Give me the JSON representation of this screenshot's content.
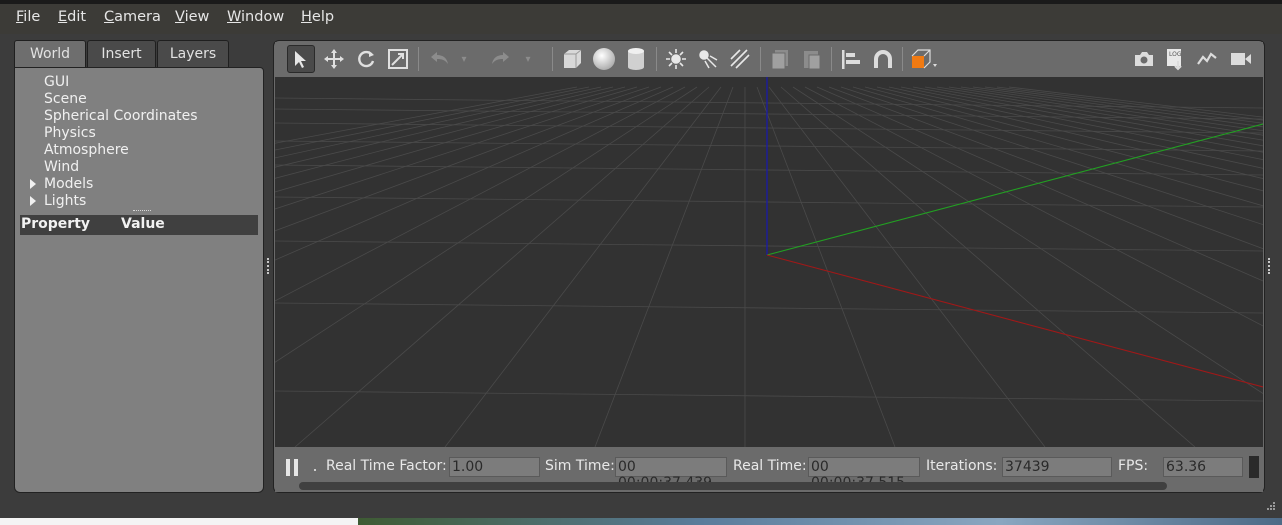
{
  "menu": [
    {
      "accel": "F",
      "rest": "ile"
    },
    {
      "accel": "E",
      "rest": "dit"
    },
    {
      "accel": "C",
      "rest": "amera"
    },
    {
      "accel": "V",
      "rest": "iew"
    },
    {
      "accel": "W",
      "rest": "indow"
    },
    {
      "accel": "H",
      "rest": "elp"
    }
  ],
  "tabs": {
    "world": "World",
    "insert": "Insert",
    "layers": "Layers"
  },
  "tree": [
    "GUI",
    "Scene",
    "Spherical Coordinates",
    "Physics",
    "Atmosphere",
    "Wind",
    "Models",
    "Lights"
  ],
  "props": {
    "property": "Property",
    "value": "Value"
  },
  "toolbar_icons": [
    "select-arrow-icon",
    "translate-icon",
    "rotate-icon",
    "scale-icon",
    "undo-icon",
    "undo-dropdown-icon",
    "redo-icon",
    "redo-dropdown-icon",
    "box-icon",
    "sphere-icon",
    "cylinder-icon",
    "point-light-icon",
    "spot-light-icon",
    "directional-light-icon",
    "copy-icon",
    "paste-icon",
    "align-icon",
    "magnet-icon",
    "view-angle-icon",
    "screenshot-icon",
    "log-icon",
    "plot-icon",
    "record-video-icon"
  ],
  "status": {
    "rtf_label": "Real Time Factor:",
    "rtf": "1.00",
    "sim_label": "Sim Time:",
    "sim": "00 00:00:37.439",
    "real_label": "Real Time:",
    "real": "00 00:00:37.515",
    "iter_label": "Iterations:",
    "iter": "37439",
    "fps_label": "FPS:",
    "fps": "63.36"
  },
  "colors": {
    "x_axis": "#a01818",
    "y_axis": "#22a022",
    "z_axis": "#1a1aa8",
    "grid": "#4a4a4a",
    "viewport_bg": "#323232"
  }
}
